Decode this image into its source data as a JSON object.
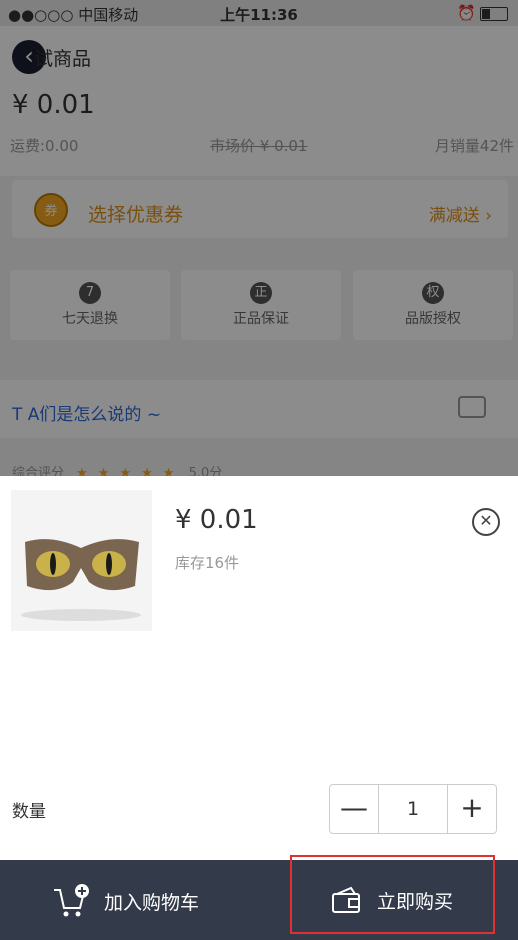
{
  "statusbar": {
    "carrier": "●●○○○ 中国移动",
    "time": "上午11:36"
  },
  "product": {
    "title": "试商品",
    "price": "¥ 0.01",
    "freight": "运费:0.00",
    "market_price": "市场价 ¥ 0.01",
    "monthly_sales": "月销量42件"
  },
  "coupon": {
    "icon_text": "券",
    "label": "选择优惠券",
    "right": "满减送 ›"
  },
  "services": [
    {
      "icon": "7",
      "label": "七天退换"
    },
    {
      "icon": "正",
      "label": "正品保证"
    },
    {
      "icon": "权",
      "label": "品版授权"
    }
  ],
  "reviews": {
    "title": "T A们是怎么说的 ~",
    "rating_label": "综合评分",
    "stars": "★★★★★",
    "score": "5.0分"
  },
  "sheet": {
    "price": "¥ 0.01",
    "stock": "库存16件",
    "quantity_label": "数量",
    "quantity": "1",
    "minus": "—",
    "plus": "+"
  },
  "bottom": {
    "add_to_cart": "加入购物车",
    "buy_now": "立即购买"
  },
  "colors": {
    "accent": "#e0901a",
    "bar": "#333a4a",
    "highlight": "#e03030",
    "link": "#2d6bd8"
  }
}
